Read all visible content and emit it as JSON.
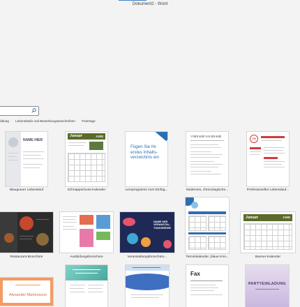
{
  "window": {
    "title": "Dokument2 - Word"
  },
  "search": {
    "placeholder": ""
  },
  "categories": [
    "bildung",
    "Lebensläufe und Bewerbungsanschreiben",
    "Feiertage"
  ],
  "templates": [
    {
      "label": "Blaugrauer Lebenslauf",
      "thumb_text": "NAME HIER"
    },
    {
      "label": "Schnappschuss-Kalender",
      "thumb_text": "Januar",
      "thumb_year": "JAHR"
    },
    {
      "label": "Lernprogramm zum Einfüg...",
      "thumb_text": "Fügen Sie Ihr erstes Inhalts-verzeichnis ein"
    },
    {
      "label": "Modernes, chronologische...",
      "thumb_text": "VORNAME NACHNAME"
    },
    {
      "label": "Professioneller Lebenslauf...",
      "thumb_text": "YN"
    },
    {
      "label": "Restaurant-Broschüre",
      "thumb_text": ""
    },
    {
      "label": "Ausbildungsbroschüre",
      "thumb_text": ""
    },
    {
      "label": "Veranstaltungsbroschüre...",
      "thumb_text": "NAME DER VERANSTAL-TUNGSREIHE"
    },
    {
      "label": "Terminkalender „blaue Krei...",
      "thumb_text": ""
    },
    {
      "label": "Banner-Kalender",
      "thumb_text": "Januar",
      "thumb_year": "JAHR"
    },
    {
      "label": "",
      "thumb_text": "Alexander Martensson"
    },
    {
      "label": "",
      "thumb_text": ""
    },
    {
      "label": "",
      "thumb_text": ""
    },
    {
      "label": "",
      "thumb_text": "Fax"
    },
    {
      "label": "",
      "thumb_text": "PARTYEINLADUNG"
    }
  ],
  "colors": {
    "calendar_header": "#5a6b2a",
    "accent": "#3b82c4"
  }
}
